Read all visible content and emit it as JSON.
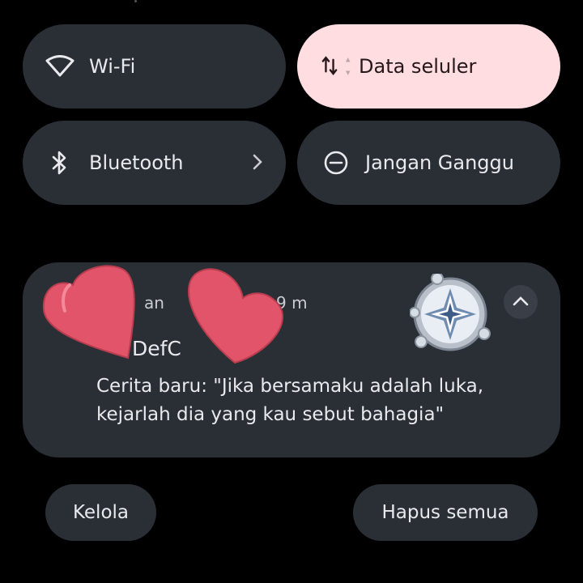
{
  "quick_settings": {
    "wifi": {
      "label": "Wi-Fi",
      "icon": "wifi-icon"
    },
    "mobile_data": {
      "label": "Data seluler",
      "icon": "mobile-data-arrows-icon",
      "accent": "#ffdde1"
    },
    "bluetooth": {
      "label": "Bluetooth",
      "icon": "bluetooth-icon"
    },
    "dnd": {
      "label": "Jangan Ganggu",
      "icon": "do-not-disturb-icon"
    }
  },
  "notification": {
    "app_name": "an",
    "time": "9 m",
    "title": "DefC",
    "body": "Cerita baru: \"Jika bersamaku adalah luka, kejarlah dia yang kau sebut bahagia\"",
    "large_icon": "diamond-sticker-icon",
    "overlay": "hearts-sticker"
  },
  "actions": {
    "manage": "Kelola",
    "clear_all": "Hapus semua"
  }
}
